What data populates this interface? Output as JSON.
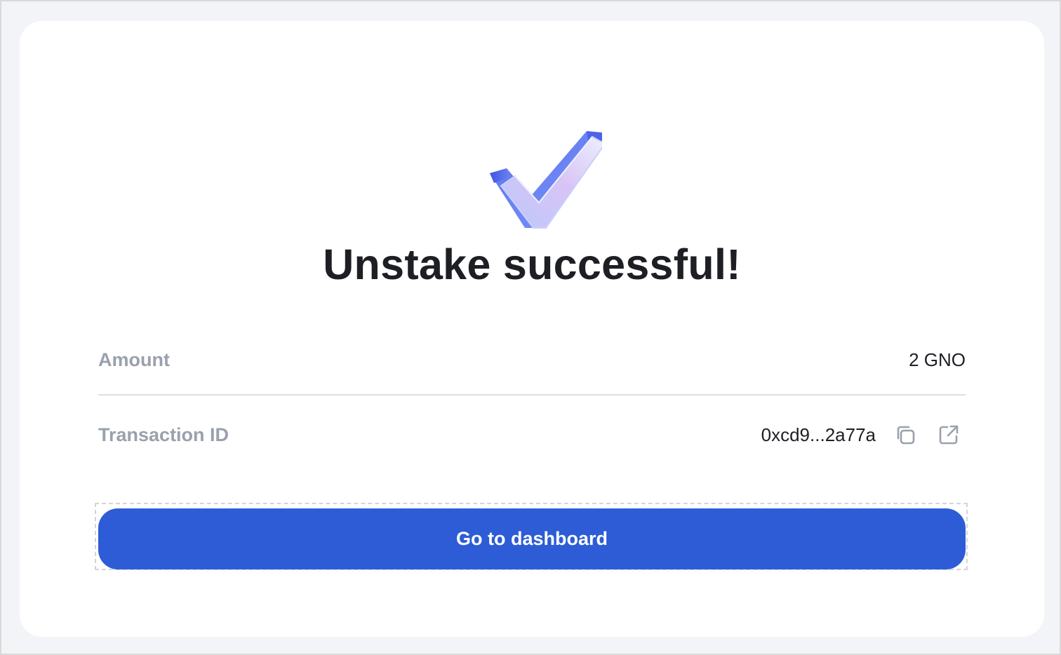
{
  "dialog": {
    "title": "Unstake successful!",
    "success_icon": "check-mark-3d-icon",
    "amount": {
      "label": "Amount",
      "value": "2 GNO"
    },
    "transaction": {
      "label": "Transaction ID",
      "value": "0xcd9...2a77a",
      "copy_icon": "copy-icon",
      "open_icon": "external-link-icon"
    },
    "cta_label": "Go to dashboard"
  },
  "colors": {
    "accent": "#2d5cd6",
    "label": "#9aa1ad",
    "text": "#1d1f24",
    "page_bg": "#f3f4f7",
    "card_bg": "#ffffff"
  }
}
